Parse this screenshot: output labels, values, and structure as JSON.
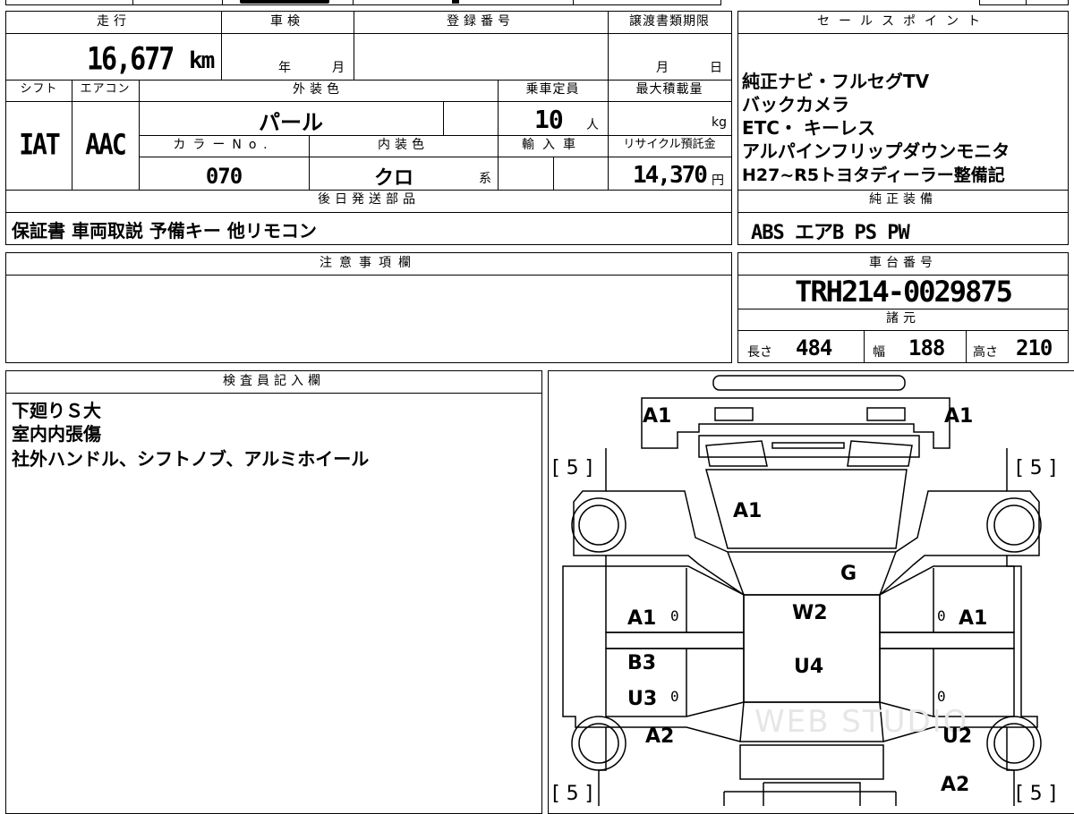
{
  "header": {
    "mileage_label": "走行",
    "shaken_label": "車検",
    "registration_label": "登録番号",
    "deadline_label": "譲渡書類期限",
    "sales_points_label": "セールスポイント",
    "shift_label": "シフト",
    "aircon_label": "エアコン",
    "exterior_color_label": "外装色",
    "capacity_label": "乗車定員",
    "max_load_label": "最大積載量",
    "color_no_label": "カラーNo.",
    "interior_color_label": "内装色",
    "import_label": "輸入車",
    "recycle_label": "リサイクル預託金",
    "later_parts_label": "後日発送部品",
    "equipment_label": "純正装備",
    "notes_label": "注意事項欄",
    "chassis_label": "車台番号",
    "specs_label": "諸元",
    "inspector_label": "検査員記入欄"
  },
  "vehicle": {
    "mileage": "16,677",
    "mileage_unit": "km",
    "shaken_year_unit": "年",
    "shaken_month_unit": "月",
    "deadline_month_unit": "月",
    "deadline_day_unit": "日",
    "shift": "IAT",
    "aircon": "AAC",
    "exterior_color": "パール",
    "capacity": "10",
    "capacity_unit": "人",
    "max_load_unit": "kg",
    "color_no": "070",
    "interior_color": "クロ",
    "interior_suffix": "系",
    "recycle_fee": "14,370",
    "recycle_unit": "円",
    "later_parts": "保証書 車両取説 予備キー 他リモコン",
    "equipment": "ABS エアB PS PW",
    "chassis_no": "TRH214-0029875",
    "length_label": "長さ",
    "length": "484",
    "width_label": "幅",
    "width": "188",
    "height_label": "高さ",
    "height": "210"
  },
  "sales_points": [
    "純正ナビ・フルセグTV",
    "バックカメラ",
    "ETC・ キーレス",
    "アルパインフリップダウンモニタ",
    "H27~R5トヨタディーラー整備記"
  ],
  "inspector_notes": [
    "下廻りＳ大",
    "室内内張傷",
    "社外ハンドル、シフトノブ、アルミホイール"
  ],
  "diagram": {
    "tire_tl": "[ 5 ]",
    "tire_tr": "[ 5 ]",
    "tire_bl": "[ 5 ]",
    "tire_br": "[ 5 ]",
    "front_left": "A1",
    "front_right": "A1",
    "hood": "A1",
    "windshield": "G",
    "left_front_door": "A1",
    "right_front_door": "A1",
    "roof_front": "W2",
    "roof_rear": "U4",
    "left_rear_upper": "B3",
    "left_rear_lower": "U3",
    "left_rear_wheel": "A2",
    "right_rear_wheel": "U2",
    "right_rear": "A2",
    "zero_1": "0",
    "zero_2": "0",
    "zero_3": "0",
    "zero_4": "0",
    "watermark": "WEB STUDIO"
  }
}
